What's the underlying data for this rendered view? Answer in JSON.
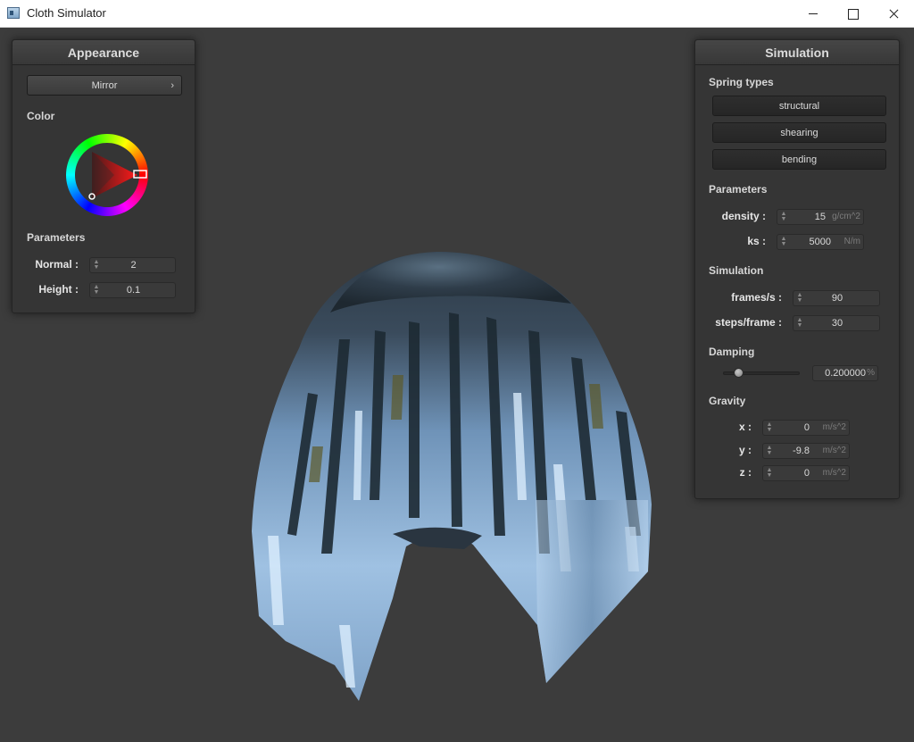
{
  "window": {
    "title": "Cloth Simulator"
  },
  "appearance": {
    "header": "Appearance",
    "shader_selected": "Mirror",
    "shader_chevron": "›",
    "color_label": "Color",
    "params_label": "Parameters",
    "normal_label": "Normal :",
    "normal_value": "2",
    "height_label": "Height :",
    "height_value": "0.1",
    "selected_color": "#ff2a2a"
  },
  "simulation": {
    "header": "Simulation",
    "spring_types_label": "Spring types",
    "springs": [
      "structural",
      "shearing",
      "bending"
    ],
    "params_label": "Parameters",
    "density_label": "density :",
    "density_value": "15",
    "density_unit": "g/cm^2",
    "ks_label": "ks :",
    "ks_value": "5000",
    "ks_unit": "N/m",
    "sim_label": "Simulation",
    "fps_label": "frames/s :",
    "fps_value": "90",
    "steps_label": "steps/frame :",
    "steps_value": "30",
    "damping_label": "Damping",
    "damping_value": "0.200000",
    "damping_unit": "%",
    "damping_fraction": 0.2,
    "gravity_label": "Gravity",
    "gx_label": "x :",
    "gx_value": "0",
    "gy_label": "y :",
    "gy_value": "-9.8",
    "gz_label": "z :",
    "gz_value": "0",
    "gravity_unit": "m/s^2"
  },
  "icons": {
    "app": "cloth-app-icon",
    "minimize": "minimize-icon",
    "maximize": "maximize-icon",
    "close": "close-icon",
    "spin": "spin-arrows-icon"
  }
}
